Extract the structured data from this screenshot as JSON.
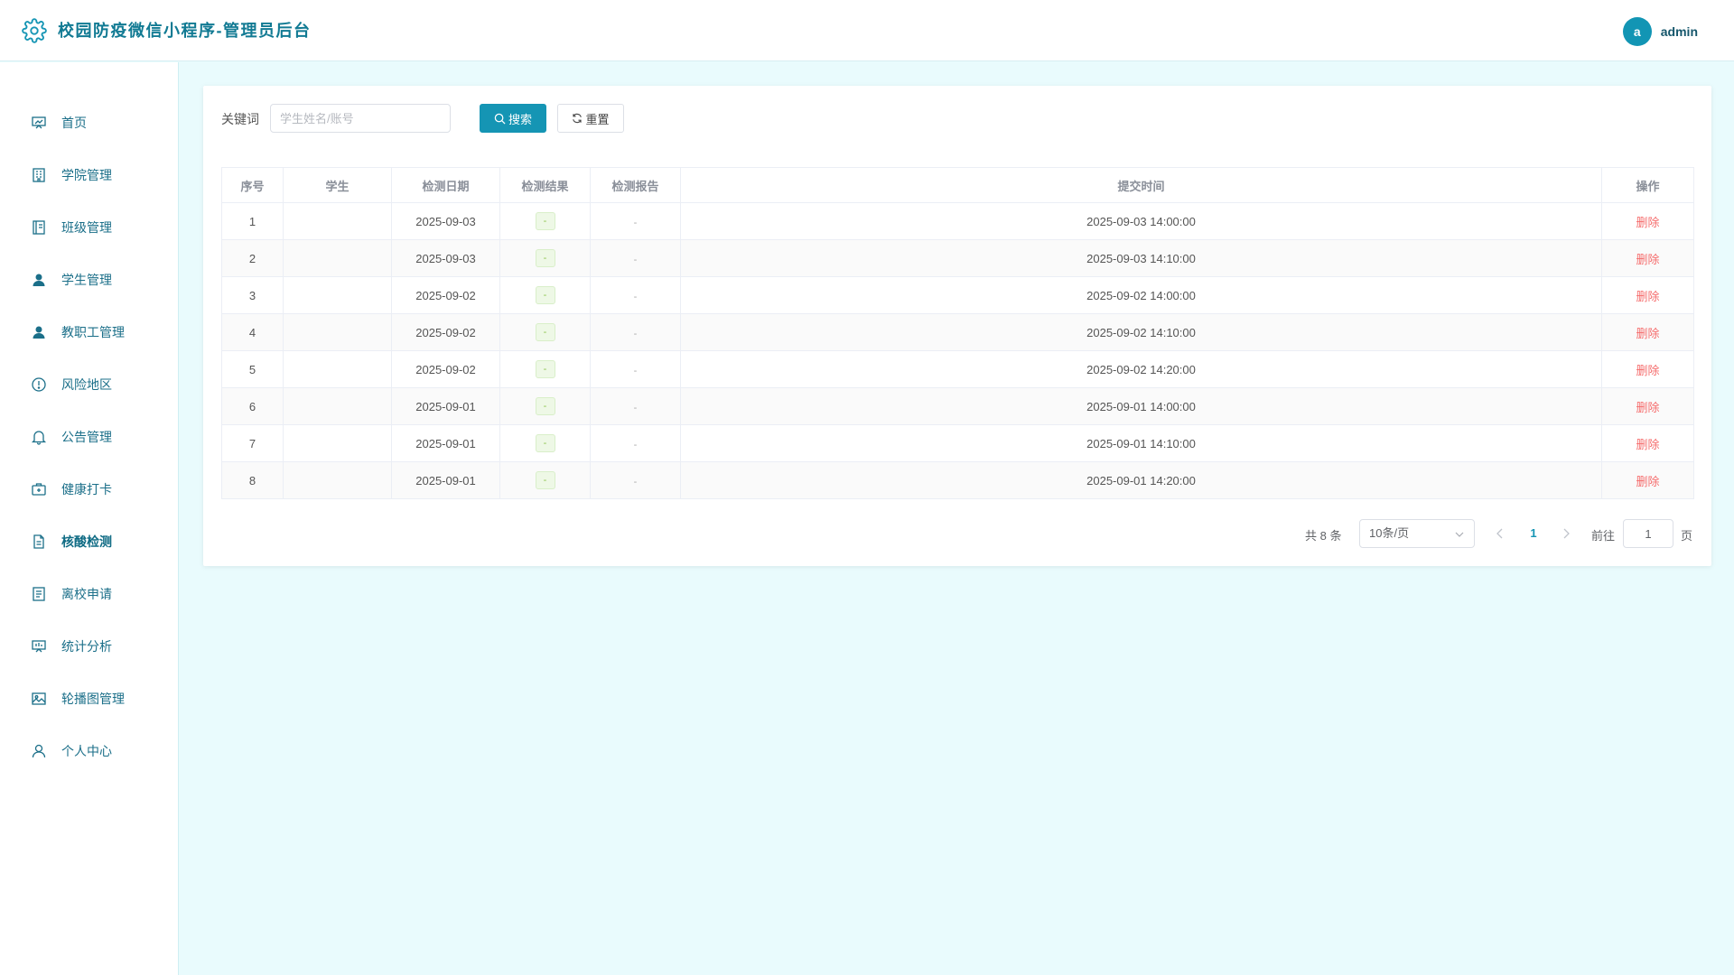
{
  "header": {
    "title": "校园防疫微信小程序-管理员后台",
    "user": {
      "avatar_letter": "a",
      "name": "admin"
    }
  },
  "sidebar": {
    "items": [
      {
        "label": "首页",
        "icon": "presentation-chart-icon"
      },
      {
        "label": "学院管理",
        "icon": "building-icon"
      },
      {
        "label": "班级管理",
        "icon": "notebook-icon"
      },
      {
        "label": "学生管理",
        "icon": "user-solid-icon"
      },
      {
        "label": "教职工管理",
        "icon": "user-solid-icon"
      },
      {
        "label": "风险地区",
        "icon": "warning-circle-icon"
      },
      {
        "label": "公告管理",
        "icon": "bell-icon"
      },
      {
        "label": "健康打卡",
        "icon": "first-aid-kit-icon"
      },
      {
        "label": "核酸检测",
        "icon": "document-icon",
        "active": true
      },
      {
        "label": "离校申请",
        "icon": "tickets-icon"
      },
      {
        "label": "统计分析",
        "icon": "data-board-icon"
      },
      {
        "label": "轮播图管理",
        "icon": "picture-icon"
      },
      {
        "label": "个人中心",
        "icon": "user-outline-icon"
      }
    ]
  },
  "search": {
    "label": "关键词",
    "placeholder": "学生姓名/账号",
    "search_button": "搜索",
    "reset_button": "重置"
  },
  "table": {
    "columns": [
      "序号",
      "学生",
      "检测日期",
      "检测结果",
      "检测报告",
      "提交时间",
      "操作"
    ],
    "rows": [
      {
        "index": "1",
        "student": "",
        "date": "2025-09-03",
        "result": "-",
        "report": "-",
        "submitted": "2025-09-03 14:00:00",
        "action": "删除"
      },
      {
        "index": "2",
        "student": "",
        "date": "2025-09-03",
        "result": "-",
        "report": "-",
        "submitted": "2025-09-03 14:10:00",
        "action": "删除"
      },
      {
        "index": "3",
        "student": "",
        "date": "2025-09-02",
        "result": "-",
        "report": "-",
        "submitted": "2025-09-02 14:00:00",
        "action": "删除"
      },
      {
        "index": "4",
        "student": "",
        "date": "2025-09-02",
        "result": "-",
        "report": "-",
        "submitted": "2025-09-02 14:10:00",
        "action": "删除"
      },
      {
        "index": "5",
        "student": "",
        "date": "2025-09-02",
        "result": "-",
        "report": "-",
        "submitted": "2025-09-02 14:20:00",
        "action": "删除"
      },
      {
        "index": "6",
        "student": "",
        "date": "2025-09-01",
        "result": "-",
        "report": "-",
        "submitted": "2025-09-01 14:00:00",
        "action": "删除"
      },
      {
        "index": "7",
        "student": "",
        "date": "2025-09-01",
        "result": "-",
        "report": "-",
        "submitted": "2025-09-01 14:10:00",
        "action": "删除"
      },
      {
        "index": "8",
        "student": "",
        "date": "2025-09-01",
        "result": "-",
        "report": "-",
        "submitted": "2025-09-01 14:20:00",
        "action": "删除"
      }
    ]
  },
  "pagination": {
    "total_text": "共 8 条",
    "page_size": "10条/页",
    "current_page": "1",
    "goto_label": "前往",
    "goto_value": "1",
    "page_suffix": "页"
  },
  "colors": {
    "primary": "#1595b4",
    "title": "#117a93",
    "background": "#e9fbfd",
    "danger": "#f56c6c",
    "tag_green": "#8bc34a"
  }
}
